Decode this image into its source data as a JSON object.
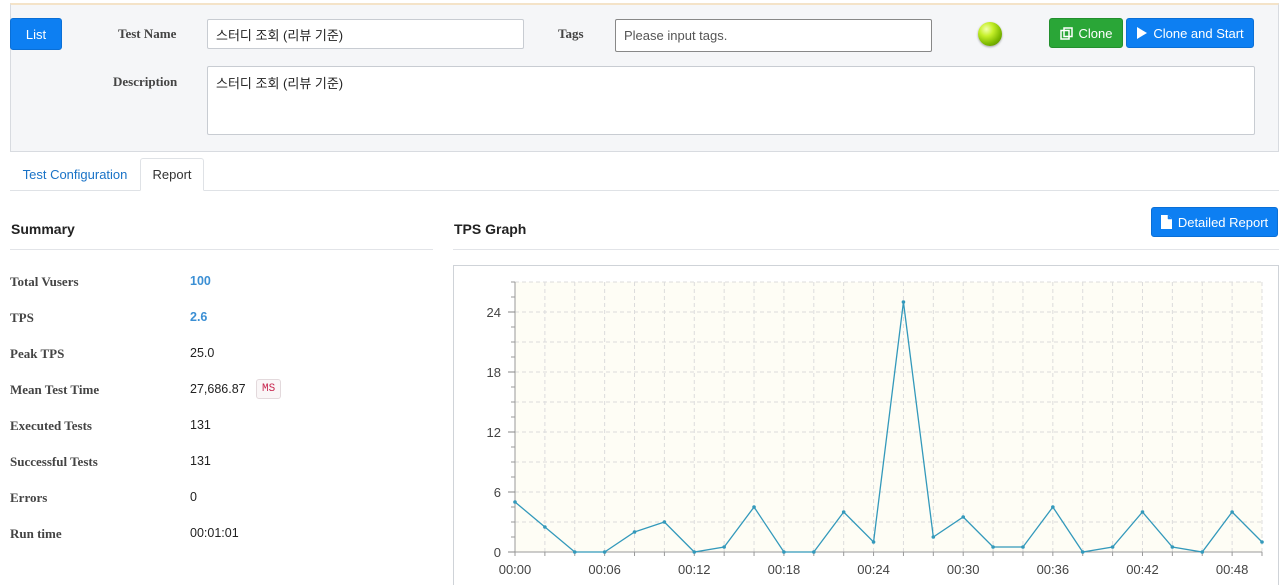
{
  "header": {
    "list_label": "List",
    "test_name_label": "Test Name",
    "test_name_value": "스터디 조회 (리뷰 기준)",
    "tags_label": "Tags",
    "tags_placeholder": "Please input tags.",
    "description_label": "Description",
    "description_value": "스터디 조회 (리뷰 기준)",
    "clone_label": "Clone",
    "clone_start_label": "Clone and Start",
    "status_color": "#8cc500"
  },
  "tabs": [
    {
      "label": "Test Configuration",
      "active": false
    },
    {
      "label": "Report",
      "active": true
    }
  ],
  "summary": {
    "title": "Summary",
    "rows": [
      {
        "label": "Total Vusers",
        "value": "100"
      },
      {
        "label": "TPS",
        "value": "2.6"
      },
      {
        "label": "Peak TPS",
        "value": "25.0"
      },
      {
        "label": "Mean Test Time",
        "value": "27,686.87",
        "unit": "MS"
      },
      {
        "label": "Executed Tests",
        "value": "131"
      },
      {
        "label": "Successful Tests",
        "value": "131"
      },
      {
        "label": "Errors",
        "value": "0"
      },
      {
        "label": "Run time",
        "value": "00:01:01"
      }
    ]
  },
  "graph": {
    "title": "TPS Graph",
    "detailed_report_label": "Detailed Report"
  },
  "chart_data": {
    "type": "line",
    "title": "TPS Graph",
    "xlabel": "",
    "ylabel": "",
    "x": [
      "00:00",
      "00:02",
      "00:04",
      "00:06",
      "00:08",
      "00:10",
      "00:12",
      "00:14",
      "00:16",
      "00:18",
      "00:20",
      "00:22",
      "00:24",
      "00:26",
      "00:28",
      "00:30",
      "00:32",
      "00:34",
      "00:36",
      "00:38",
      "00:40",
      "00:42",
      "00:44",
      "00:46",
      "00:48",
      "00:50"
    ],
    "x_ticks": [
      "00:00",
      "00:06",
      "00:12",
      "00:18",
      "00:24",
      "00:30",
      "00:36",
      "00:42",
      "00:48"
    ],
    "series": [
      {
        "values": [
          5,
          2.5,
          0,
          0,
          2,
          3,
          0,
          0.5,
          4.5,
          0,
          0,
          4,
          1,
          25,
          1.5,
          3.5,
          0.5,
          0.5,
          4.5,
          0,
          0.5,
          4,
          0.5,
          0,
          4,
          1
        ]
      }
    ],
    "ylim": [
      0,
      27
    ],
    "y_ticks": [
      0,
      6,
      12,
      18,
      24
    ],
    "grid": true,
    "line_color": "#3399bb",
    "background_color": "#fefdf5"
  }
}
